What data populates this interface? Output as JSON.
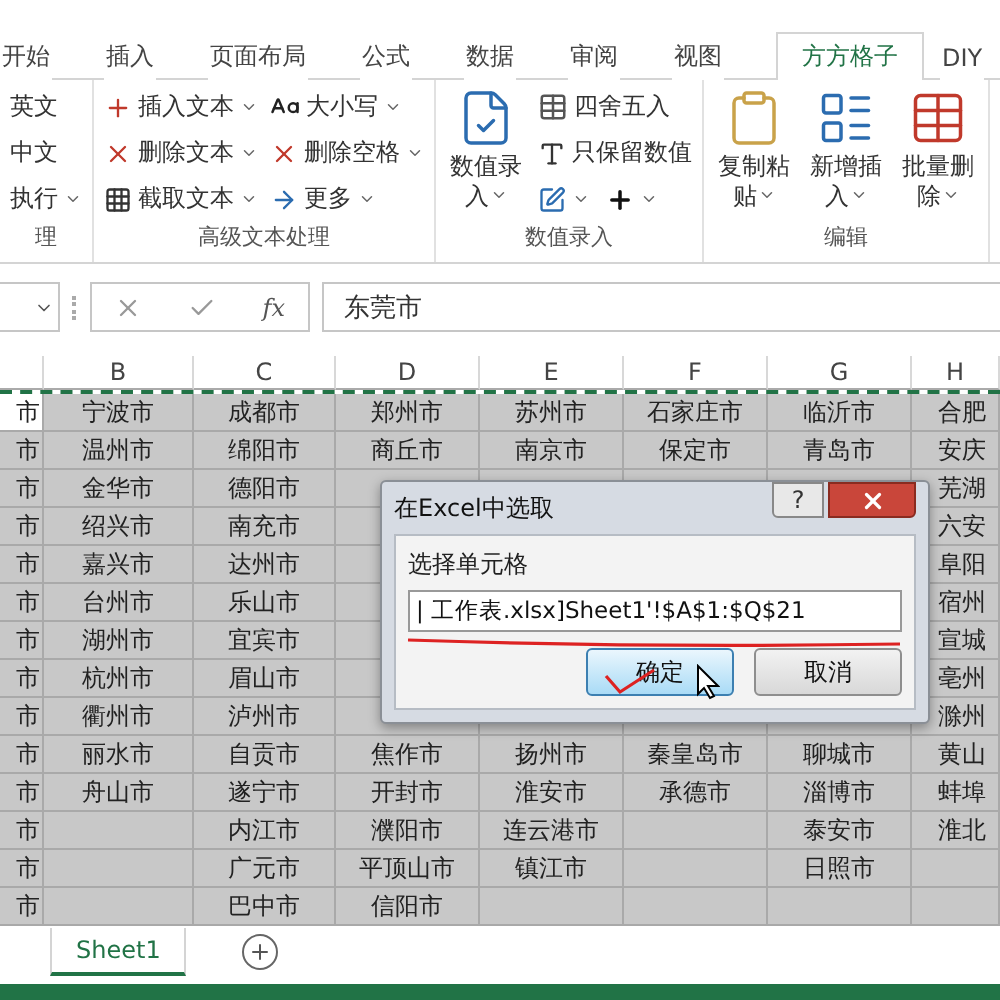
{
  "tabs": [
    {
      "label": "开始",
      "selected": false
    },
    {
      "label": "插入",
      "selected": false
    },
    {
      "label": "页面布局",
      "selected": false
    },
    {
      "label": "公式",
      "selected": false
    },
    {
      "label": "数据",
      "selected": false
    },
    {
      "label": "审阅",
      "selected": false
    },
    {
      "label": "视图",
      "selected": false
    },
    {
      "label": "方方格子",
      "selected": true
    },
    {
      "label": "DIY",
      "selected": false
    }
  ],
  "ribbon": {
    "groups": [
      {
        "label": "理",
        "columns": [
          {
            "kind": "stack",
            "items": [
              {
                "kind": "text",
                "label": "英文",
                "dropdown": false
              },
              {
                "kind": "text",
                "label": "中文",
                "dropdown": false
              },
              {
                "kind": "text",
                "label": "执行",
                "dropdown": true
              }
            ]
          }
        ]
      },
      {
        "label": "高级文本处理",
        "columns": [
          {
            "kind": "stack",
            "items": [
              {
                "kind": "text",
                "label": "插入文本",
                "dropdown": true
              },
              {
                "kind": "text",
                "label": "删除文本",
                "dropdown": true
              },
              {
                "kind": "text",
                "label": "截取文本",
                "dropdown": true
              }
            ]
          },
          {
            "kind": "stack",
            "items": [
              {
                "kind": "text",
                "label": "大小写",
                "dropdown": true
              },
              {
                "kind": "text",
                "label": "删除空格",
                "dropdown": true
              },
              {
                "kind": "text",
                "label": "更多",
                "dropdown": true
              }
            ]
          }
        ]
      },
      {
        "label": "数值录入",
        "columns": [
          {
            "kind": "large",
            "label": "数值录入",
            "dropdown": true
          },
          {
            "kind": "stack",
            "items": [
              {
                "kind": "text",
                "label": "四舍五入",
                "dropdown": false
              },
              {
                "kind": "text",
                "label": "只保留数值",
                "dropdown": false
              },
              {
                "kind": "icons",
                "buttons": [
                  {
                    "dropdown": true
                  },
                  {
                    "dropdown": true
                  }
                ]
              }
            ]
          }
        ]
      },
      {
        "label": "编辑",
        "columns": [
          {
            "kind": "large",
            "label": "复制粘贴",
            "dropdown": true
          },
          {
            "kind": "large",
            "label": "新增插入",
            "dropdown": true
          },
          {
            "kind": "large",
            "label": "批量删除",
            "dropdown": true
          }
        ]
      }
    ]
  },
  "formula_bar": {
    "fx_label": "fx",
    "value": "东莞市"
  },
  "sheet": {
    "columns": [
      "",
      "B",
      "C",
      "D",
      "E",
      "F",
      "G",
      "H"
    ],
    "rows": [
      {
        "first_cell_active": true,
        "cells": [
          "市",
          "宁波市",
          "成都市",
          "郑州市",
          "苏州市",
          "石家庄市",
          "临沂市",
          "合肥"
        ]
      },
      {
        "first_cell_active": false,
        "cells": [
          "市",
          "温州市",
          "绵阳市",
          "商丘市",
          "南京市",
          "保定市",
          "青岛市",
          "安庆"
        ]
      },
      {
        "first_cell_active": false,
        "cells": [
          "市",
          "金华市",
          "德阳市",
          null,
          null,
          null,
          null,
          "芜湖"
        ]
      },
      {
        "first_cell_active": false,
        "cells": [
          "市",
          "绍兴市",
          "南充市",
          null,
          null,
          null,
          null,
          "六安"
        ]
      },
      {
        "first_cell_active": false,
        "cells": [
          "市",
          "嘉兴市",
          "达州市",
          null,
          null,
          null,
          null,
          "阜阳"
        ]
      },
      {
        "first_cell_active": false,
        "cells": [
          "市",
          "台州市",
          "乐山市",
          null,
          null,
          null,
          null,
          "宿州"
        ]
      },
      {
        "first_cell_active": false,
        "cells": [
          "市",
          "湖州市",
          "宜宾市",
          null,
          null,
          null,
          null,
          "宣城"
        ]
      },
      {
        "first_cell_active": false,
        "cells": [
          "市",
          "杭州市",
          "眉山市",
          null,
          null,
          null,
          null,
          "亳州"
        ]
      },
      {
        "first_cell_active": false,
        "cells": [
          "市",
          "衢州市",
          "泸州市",
          null,
          null,
          null,
          null,
          "滁州"
        ]
      },
      {
        "first_cell_active": false,
        "cells": [
          "市",
          "丽水市",
          "自贡市",
          "焦作市",
          "扬州市",
          "秦皇岛市",
          "聊城市",
          "黄山"
        ]
      },
      {
        "first_cell_active": false,
        "cells": [
          "市",
          "舟山市",
          "遂宁市",
          "开封市",
          "淮安市",
          "承德市",
          "淄博市",
          "蚌埠"
        ]
      },
      {
        "first_cell_active": false,
        "cells": [
          "市",
          null,
          "内江市",
          "濮阳市",
          "连云港市",
          null,
          "泰安市",
          "淮北"
        ]
      },
      {
        "first_cell_active": false,
        "cells": [
          "市",
          null,
          "广元市",
          "平顶山市",
          "镇江市",
          null,
          "日照市",
          null
        ]
      },
      {
        "first_cell_active": false,
        "cells": [
          "市",
          null,
          "巴中市",
          "信阳市",
          null,
          null,
          null,
          null
        ]
      }
    ]
  },
  "dialog": {
    "title": "在Excel中选取",
    "help_label": "?",
    "label": "选择单元格",
    "value": "| 工作表.xlsx]Sheet1'!$A$1:$Q$21",
    "buttons": [
      {
        "label": "确定",
        "selected": true
      },
      {
        "label": "取消",
        "selected": false
      }
    ]
  },
  "sheet_tabs": [
    {
      "label": "Sheet1",
      "selected": true
    }
  ]
}
